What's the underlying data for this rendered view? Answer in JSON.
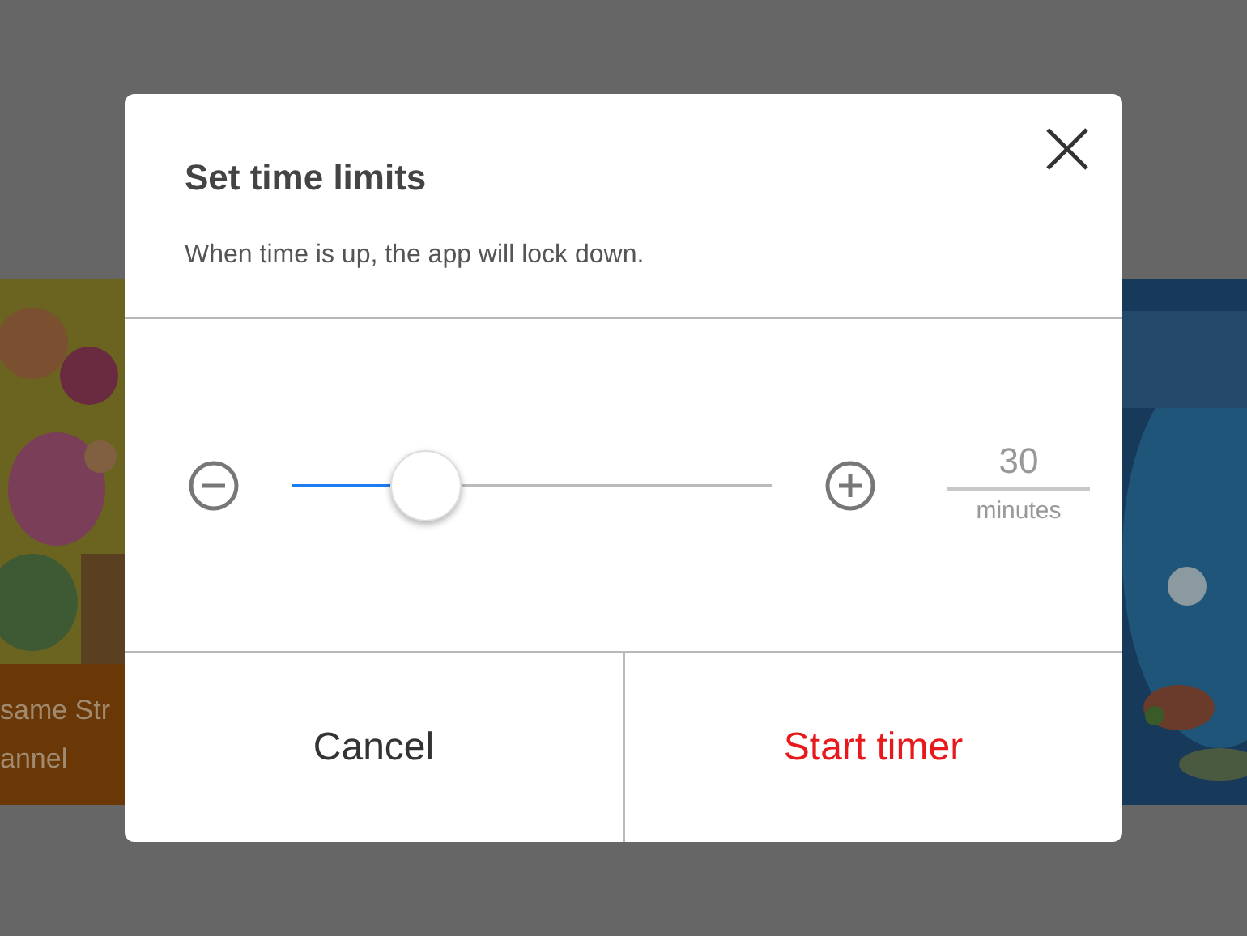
{
  "background": {
    "left_card": {
      "caption_lines": [
        "same Str",
        "annel"
      ]
    }
  },
  "dialog": {
    "title": "Set time limits",
    "message": "When time is up, the app will lock down.",
    "slider": {
      "level": 0.28,
      "value": "30",
      "unit": "minutes"
    },
    "buttons": [
      {
        "label": "Cancel",
        "kind": "cancel"
      },
      {
        "label": "Start timer",
        "kind": "primary"
      }
    ]
  }
}
